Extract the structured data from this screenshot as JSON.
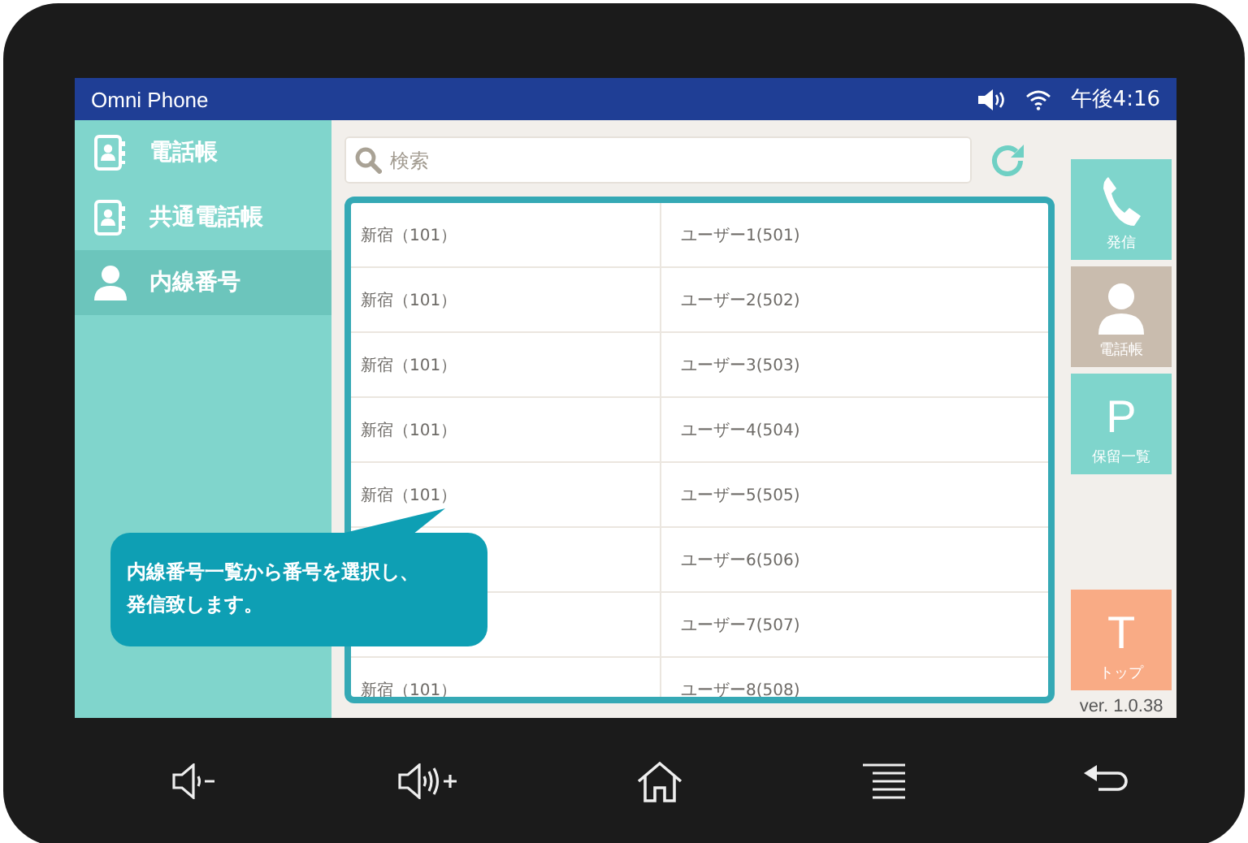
{
  "window": {
    "title": "Omni Phone"
  },
  "status_bar": {
    "time": "午後4:16"
  },
  "sidebar": {
    "items": [
      {
        "label": "電話帳",
        "kind": "book",
        "selected": false
      },
      {
        "label": "共通電話帳",
        "kind": "book",
        "selected": false
      },
      {
        "label": "内線番号",
        "kind": "person",
        "selected": true
      }
    ]
  },
  "search": {
    "placeholder": "検索"
  },
  "table": {
    "rows": [
      {
        "column_1": "新宿（101）",
        "column_2": "ユーザー1(501)"
      },
      {
        "column_1": "新宿（101）",
        "column_2": "ユーザー2(502)"
      },
      {
        "column_1": "新宿（101）",
        "column_2": "ユーザー3(503)"
      },
      {
        "column_1": "新宿（101）",
        "column_2": "ユーザー4(504)"
      },
      {
        "column_1": "新宿（101）",
        "column_2": "ユーザー5(505)"
      },
      {
        "column_2": "ユーザー6(506)"
      },
      {
        "column_2": "ユーザー7(507)"
      },
      {
        "column_1": "新宿（101）",
        "column_2": "ユーザー8(508)"
      }
    ]
  },
  "action_buttons": [
    {
      "kind": "phone",
      "label": "発信",
      "color": "#7fd5cc"
    },
    {
      "kind": "person",
      "label": "電話帳",
      "color": "#c9bcae"
    },
    {
      "kind": "letter",
      "glyph": "P",
      "label": "保留一覧",
      "color": "#7fd5cc"
    },
    {
      "kind": "letter",
      "glyph": "T",
      "label": "トップ",
      "color": "#f9ab85"
    }
  ],
  "version": "ver. 1.0.38",
  "callout": {
    "lines": [
      "内線番号一覧から番号を選択し、",
      "発信致します。"
    ]
  }
}
